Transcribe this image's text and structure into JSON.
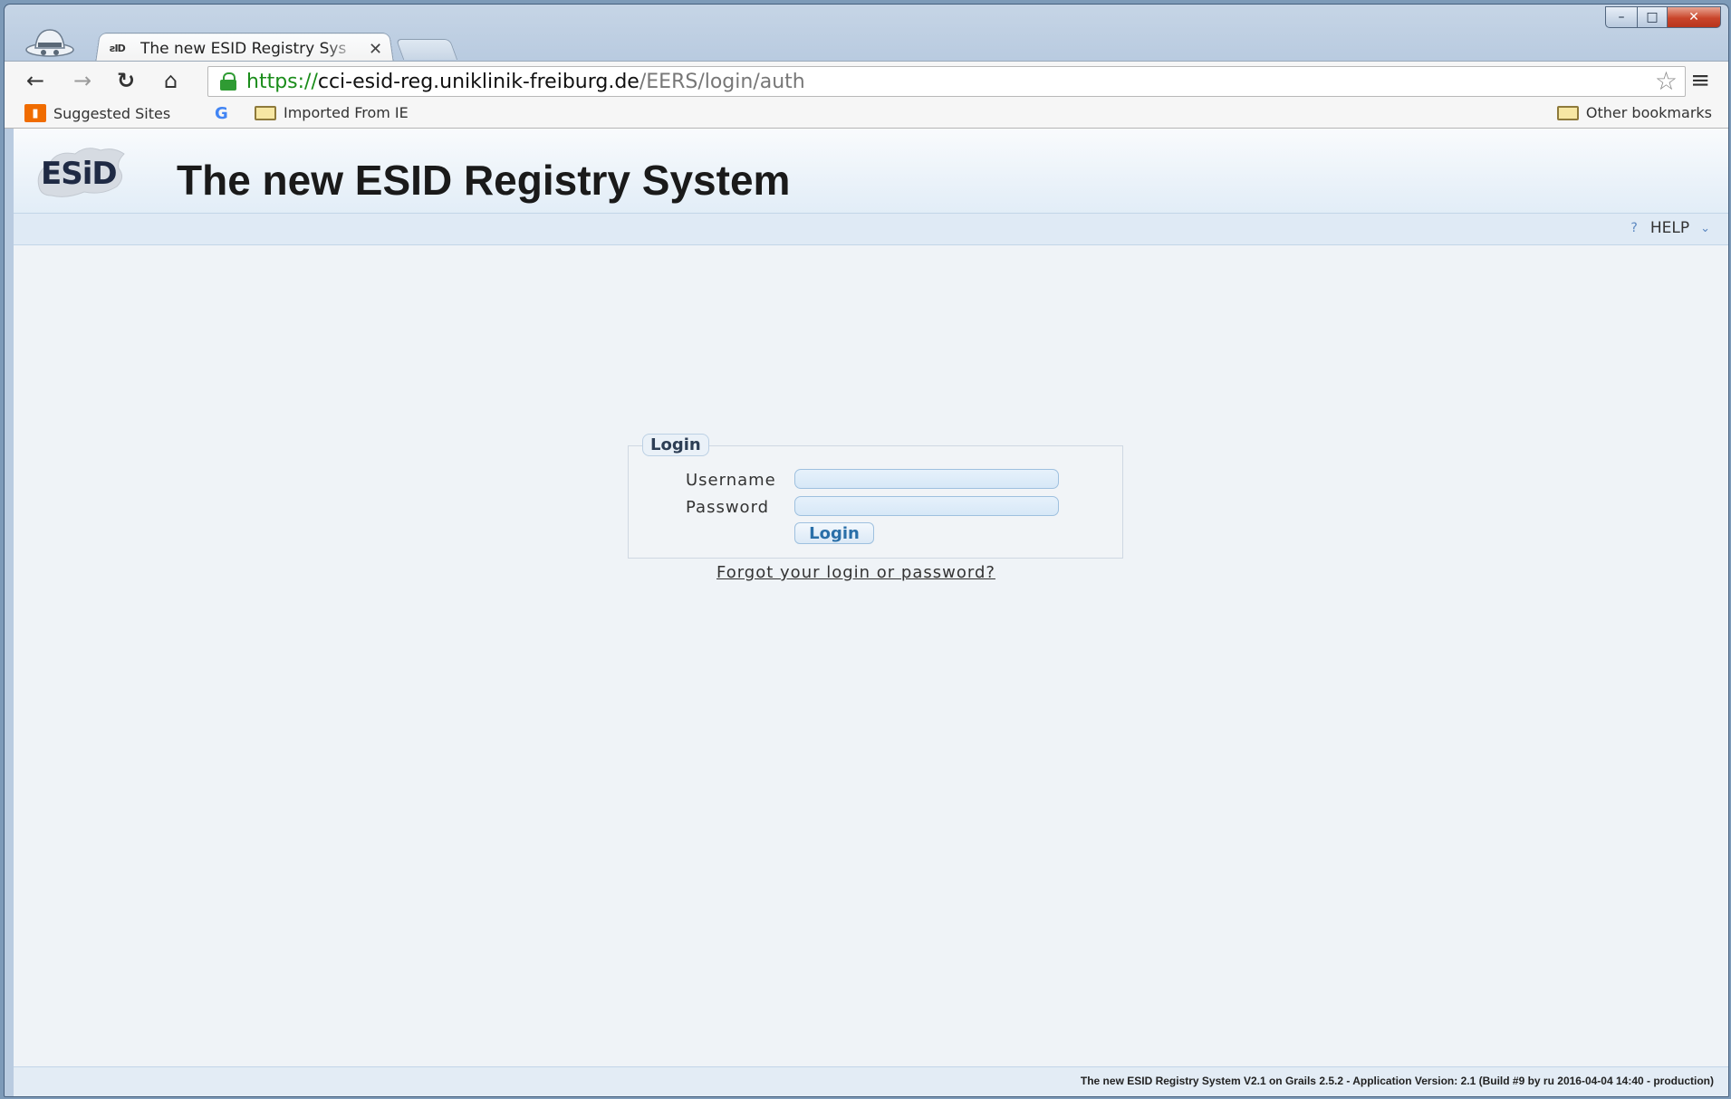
{
  "browser": {
    "tab": {
      "favicon_text": "ƨID",
      "title": "The new ESID Registry Sys",
      "close_glyph": "✕"
    },
    "window_controls": {
      "minimize_glyph": "–",
      "maximize_glyph": "□",
      "close_glyph": "✕"
    },
    "nav": {
      "back_glyph": "←",
      "forward_glyph": "→",
      "reload_glyph": "↻",
      "home_glyph": "⌂",
      "star_glyph": "☆",
      "menu_glyph": "≡"
    },
    "url": {
      "scheme": "https://",
      "host": "cci-esid-reg.uniklinik-freiburg.de",
      "path": "/EERS/login/auth"
    },
    "bookmarks": {
      "suggested": "Suggested Sites",
      "google_glyph": "G",
      "imported": "Imported From IE",
      "other": "Other bookmarks"
    }
  },
  "app": {
    "logo_text": "ESiD",
    "title": "The new ESID Registry System",
    "help": {
      "q_glyph": "?",
      "label": "HELP",
      "chevron": "⌄"
    },
    "login": {
      "legend": "Login",
      "username_label": "Username",
      "password_label": "Password",
      "username_value": "",
      "password_value": "",
      "button_label": "Login",
      "forgot_link": "Forgot your login or password?"
    },
    "footer": "The new ESID Registry System V2.1 on Grails 2.5.2 - Application Version: 2.1 (Build #9 by ru 2016-04-04 14:40 - production)"
  },
  "colors": {
    "url_scheme": "#1a8c1a",
    "page_bg": "#eff3f7",
    "help_bar": "#dfeaf5",
    "accent": "#2a6fa8"
  }
}
